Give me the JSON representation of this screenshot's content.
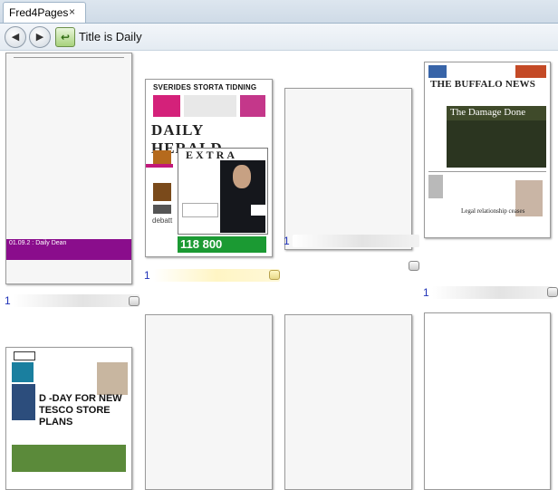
{
  "window": {
    "tab_label": "Fred4Pages",
    "tab_close": "×"
  },
  "toolbar": {
    "back_glyph": "◀",
    "forward_glyph": "▶",
    "up_glyph": "↩",
    "breadcrumb": "Title is Daily"
  },
  "pages": [
    {
      "number": "1",
      "text": "01.09.2 : Daily Dean",
      "selected": false
    },
    {
      "number": "1",
      "top_banner": "SVERIDES STORTA TIDNING",
      "mast": "DAILY HERALD",
      "extra": "EXTRA",
      "ad": "118 800",
      "side": "debatt",
      "selected": true
    },
    {
      "number": "1",
      "selected": false
    },
    {
      "number": "1",
      "mast": "THE BUFFALO NEWS",
      "headline": "The Damage Done",
      "subhead": "Legal relationship ceases",
      "selected": false
    },
    {
      "headline": "D -DAY FOR NEW TESCO STORE PLANS"
    },
    {},
    {},
    {}
  ]
}
